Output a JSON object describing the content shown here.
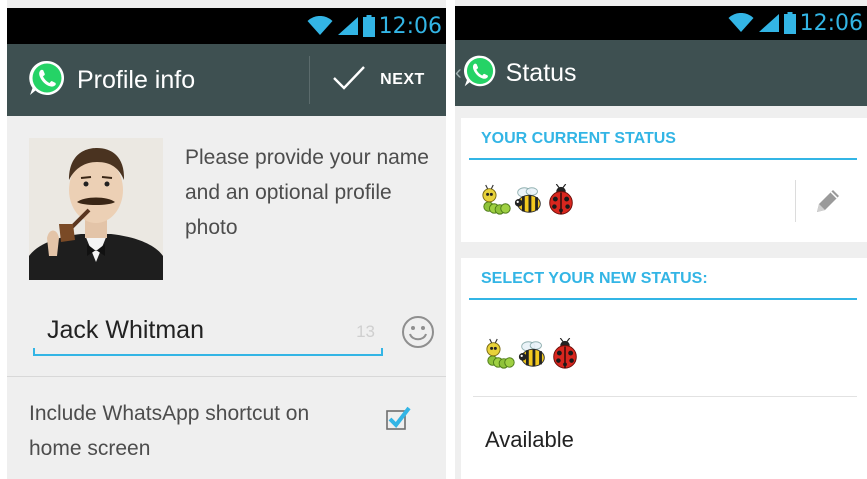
{
  "left": {
    "status_bar": {
      "time": "12:06"
    },
    "action_bar": {
      "title": "Profile info",
      "next_label": "NEXT"
    },
    "prompt": "Please provide your name and an optional profile photo",
    "name_field": {
      "value": "Jack Whitman",
      "char_count": "13"
    },
    "shortcut": {
      "label": "Include WhatsApp shortcut on home screen",
      "checked": true
    }
  },
  "right": {
    "status_bar": {
      "time": "12:06"
    },
    "action_bar": {
      "title": "Status"
    },
    "current_status": {
      "header": "YOUR CURRENT STATUS",
      "emoji": [
        "caterpillar",
        "bee",
        "ladybug"
      ]
    },
    "new_status": {
      "header": "SELECT YOUR NEW STATUS:",
      "options": [
        {
          "emoji": [
            "caterpillar",
            "bee",
            "ladybug"
          ]
        },
        {
          "label": "Available"
        }
      ]
    }
  },
  "colors": {
    "accent": "#33b5e5",
    "actionbar": "#3e5051",
    "whatsapp_green": "#25d366",
    "text": "#4d4d4d"
  }
}
